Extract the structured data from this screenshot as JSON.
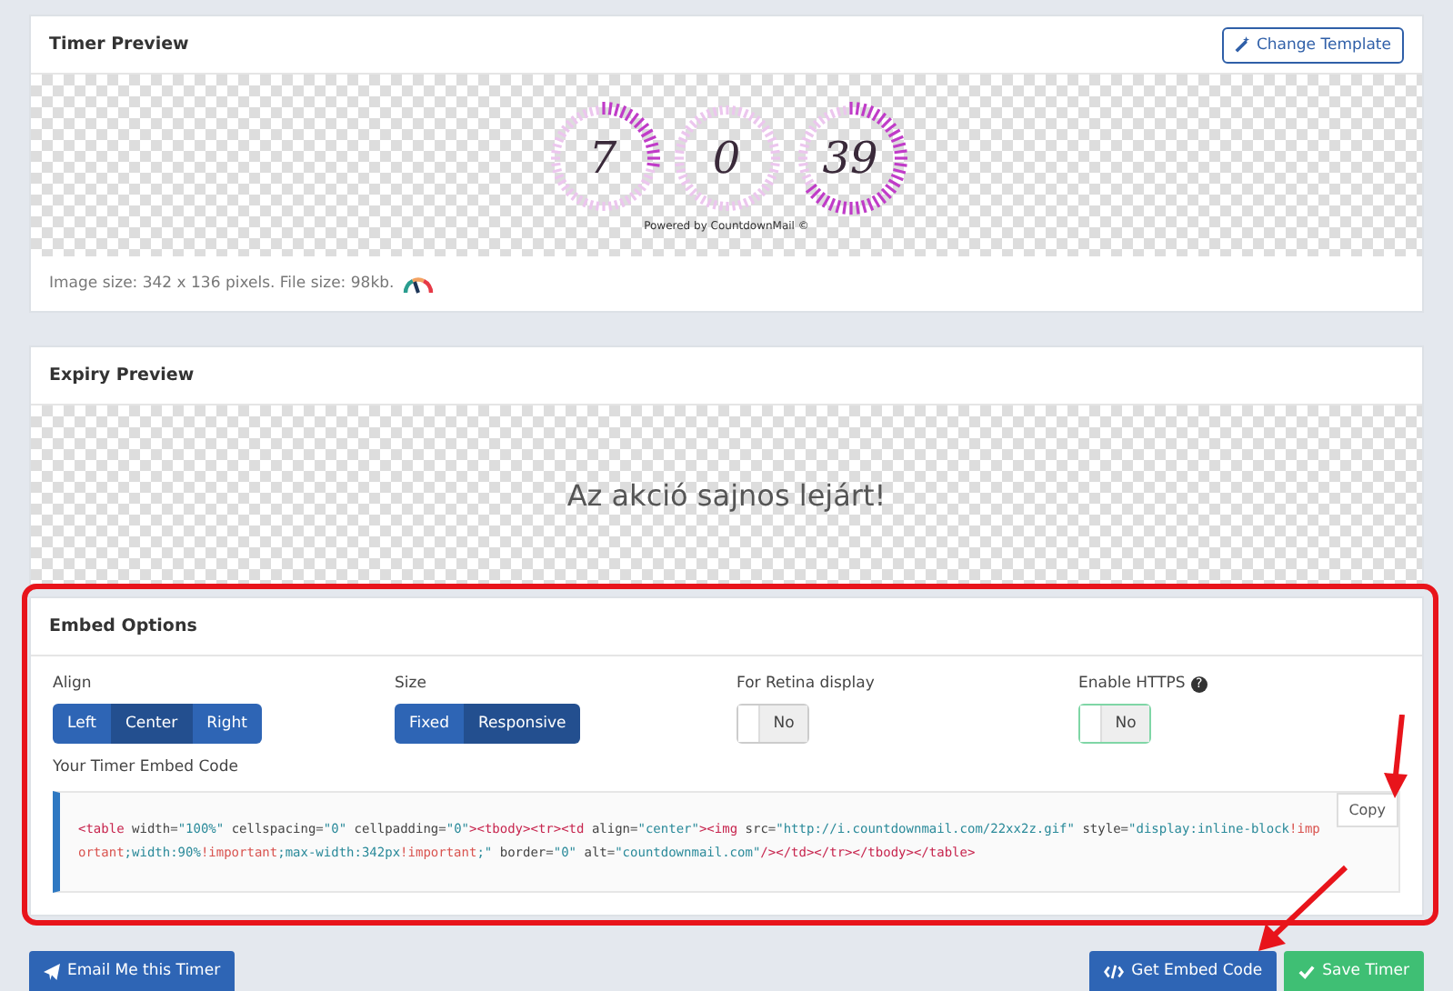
{
  "timer_preview": {
    "title": "Timer Preview",
    "change_template_button": "Change Template",
    "timer": {
      "units": [
        {
          "value": "7"
        },
        {
          "value": "0"
        },
        {
          "value": "39"
        }
      ],
      "powered_by": "Powered by CountdownMail ©"
    },
    "image_info": "Image size: 342 x 136 pixels. File size: 98kb."
  },
  "expiry_preview": {
    "title": "Expiry Preview",
    "message": "Az akció sajnos lejárt!"
  },
  "embed_options": {
    "title": "Embed Options",
    "align": {
      "label": "Align",
      "options": [
        {
          "label": "Left",
          "selected": false
        },
        {
          "label": "Center",
          "selected": true
        },
        {
          "label": "Right",
          "selected": false
        }
      ]
    },
    "size": {
      "label": "Size",
      "options": [
        {
          "label": "Fixed",
          "selected": false
        },
        {
          "label": "Responsive",
          "selected": true
        }
      ]
    },
    "retina": {
      "label": "For Retina display",
      "value": "No",
      "on": false
    },
    "https": {
      "label": "Enable HTTPS",
      "value": "No",
      "on": false,
      "help": "?"
    },
    "embed_code": {
      "label": "Your Timer Embed Code",
      "copy_button": "Copy",
      "tokens": [
        {
          "kind": "tag",
          "text": "<table"
        },
        {
          "kind": "attr",
          "text": " width="
        },
        {
          "kind": "value",
          "text": "\"100%\""
        },
        {
          "kind": "attr",
          "text": " cellspacing="
        },
        {
          "kind": "value",
          "text": "\"0\""
        },
        {
          "kind": "attr",
          "text": " cellpadding="
        },
        {
          "kind": "value",
          "text": "\"0\""
        },
        {
          "kind": "tag",
          "text": "><tbody><tr><td"
        },
        {
          "kind": "attr",
          "text": " align="
        },
        {
          "kind": "value",
          "text": "\"center\""
        },
        {
          "kind": "tag",
          "text": "><img"
        },
        {
          "kind": "attr",
          "text": " src="
        },
        {
          "kind": "value",
          "text": "\"http://i.countdownmail.com/22xx2z.gif\""
        },
        {
          "kind": "attr",
          "text": " style="
        },
        {
          "kind": "value",
          "text": "\"display:inline-block"
        },
        {
          "kind": "keyword",
          "text": "!important"
        },
        {
          "kind": "value",
          "text": ";width:90%"
        },
        {
          "kind": "keyword",
          "text": "!important"
        },
        {
          "kind": "value",
          "text": ";max-width:342px"
        },
        {
          "kind": "keyword",
          "text": "!important"
        },
        {
          "kind": "value",
          "text": ";\""
        },
        {
          "kind": "attr",
          "text": " border="
        },
        {
          "kind": "value",
          "text": "\"0\""
        },
        {
          "kind": "attr",
          "text": " alt="
        },
        {
          "kind": "value",
          "text": "\"countdownmail.com\""
        },
        {
          "kind": "tag",
          "text": "/></td></tr></tbody></table>"
        }
      ]
    }
  },
  "footer": {
    "email_button": "Email Me this Timer",
    "embed_button": "Get Embed Code",
    "save_button": "Save Timer"
  }
}
